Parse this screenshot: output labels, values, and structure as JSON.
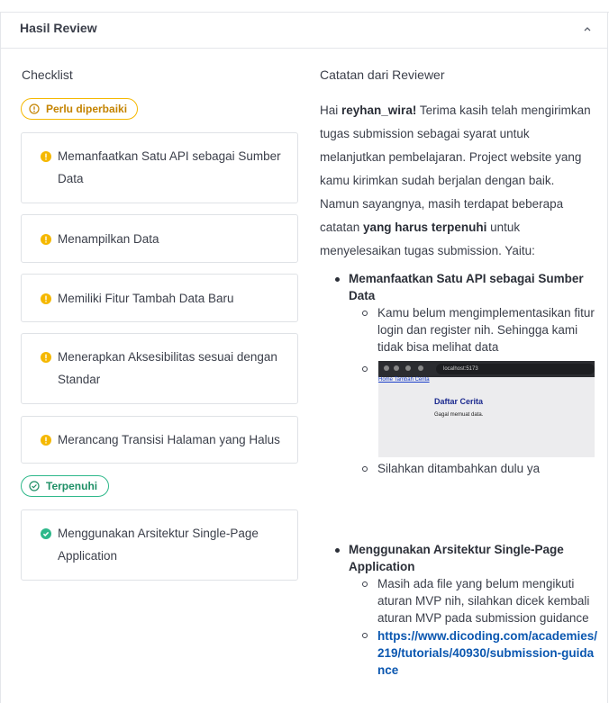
{
  "panel": {
    "title": "Hasil Review",
    "collapse_icon": "chevron-up-icon"
  },
  "checklist": {
    "title": "Checklist",
    "badge_warn": "Perlu diperbaiki",
    "warn_items": [
      "Memanfaatkan Satu API sebagai Sumber Data",
      "Menampilkan Data",
      "Memiliki Fitur Tambah Data Baru",
      "Menerapkan Aksesibilitas sesuai dengan Standar",
      "Merancang Transisi Halaman yang Halus"
    ],
    "badge_ok": "Terpenuhi",
    "ok_items": [
      "Menggunakan Arsitektur Single-Page Application"
    ],
    "colors": {
      "warn": "#f5b800",
      "ok": "#2eb88a"
    }
  },
  "notes": {
    "title": "Catatan dari Reviewer",
    "greeting": "Hai",
    "username": "reyhan_wira!",
    "para1": " Terima kasih telah mengirimkan tugas submission sebagai syarat untuk melanjutkan pembelajaran. Project website yang kamu kirimkan sudah berjalan dengan baik. Namun sayangnya, masih terdapat beberapa catatan ",
    "emphasis": "yang harus terpenuhi",
    "para2": " untuk menyelesaikan tugas submission. Yaitu:",
    "items": [
      {
        "title": "Memanfaatkan Satu API sebagai Sumber Data",
        "sub": [
          "Kamu belum mengimplementasikan fitur login dan register nih. Sehingga kami tidak bisa melihat data",
          "Silahkan ditambahkan dulu ya"
        ]
      },
      {
        "title": "Menggunakan Arsitektur Single-Page Application",
        "sub": [
          "Masih ada file yang belum mengikuti aturan MVP nih, silahkan dicek kembali aturan MVP pada submission guidance",
          "https://www.dicoding.com/academies/219/tutorials/40930/submission-guidance"
        ]
      }
    ],
    "screenshot": {
      "url": "localhost:5173",
      "nav": "Home Tambah Cerita",
      "heading": "Daftar Cerita",
      "message": "Gagal memuat data."
    }
  }
}
